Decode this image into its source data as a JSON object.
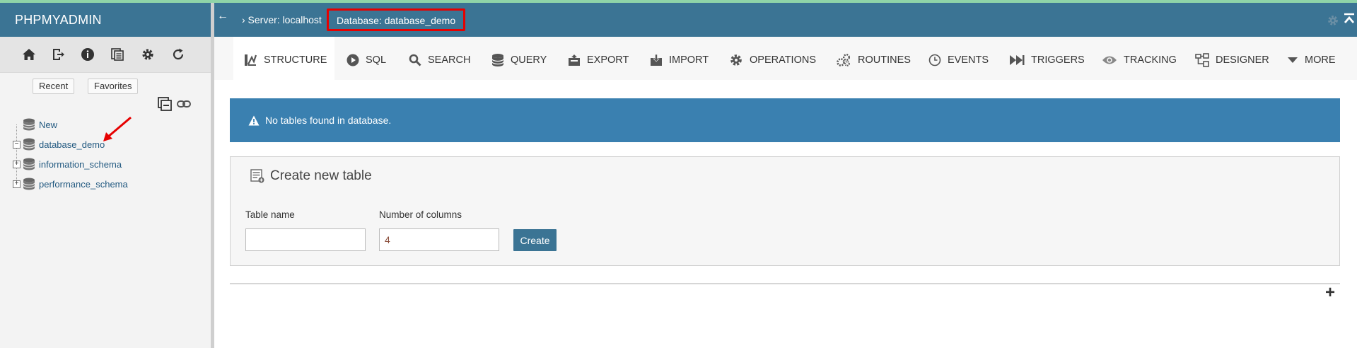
{
  "app": {
    "brand": "PHPMYADMIN"
  },
  "colors": {
    "brand_bar": "#3b7494",
    "notice": "#3a80b0",
    "highlight_box": "#e60000",
    "link": "#235a81"
  },
  "nav_icons": [
    "home-icon",
    "logout-icon",
    "info-icon",
    "docs-icon",
    "settings-icon",
    "reload-icon"
  ],
  "nav": {
    "recent_label": "Recent",
    "favorites_label": "Favorites",
    "tree": [
      {
        "label": "New",
        "expander": ""
      },
      {
        "label": "database_demo",
        "expander": "−"
      },
      {
        "label": "information_schema",
        "expander": "+"
      },
      {
        "label": "performance_schema",
        "expander": "+"
      }
    ]
  },
  "topbar": {
    "collapse_arrow": "←",
    "server_crumb": "› Server: localhost",
    "database_crumb": "Database: database_demo"
  },
  "tabs": [
    {
      "label": "Structure",
      "icon": "structure-icon",
      "active": true
    },
    {
      "label": "SQL",
      "icon": "sql-icon"
    },
    {
      "label": "Search",
      "icon": "search-icon"
    },
    {
      "label": "Query",
      "icon": "query-icon"
    },
    {
      "label": "Export",
      "icon": "export-icon"
    },
    {
      "label": "Import",
      "icon": "import-icon"
    },
    {
      "label": "Operations",
      "icon": "operations-icon"
    },
    {
      "label": "Routines",
      "icon": "routines-icon"
    },
    {
      "label": "Events",
      "icon": "events-icon"
    },
    {
      "label": "Triggers",
      "icon": "triggers-icon"
    },
    {
      "label": "Tracking",
      "icon": "tracking-icon"
    },
    {
      "label": "Designer",
      "icon": "designer-icon"
    },
    {
      "label": "More",
      "icon": "more-caret-icon"
    }
  ],
  "notice": {
    "text": "No tables found in database."
  },
  "create_table": {
    "legend": "Create new table",
    "table_name_label": "Table name",
    "table_name_value": "",
    "columns_label": "Number of columns",
    "columns_value": "4",
    "create_button": "Create"
  }
}
